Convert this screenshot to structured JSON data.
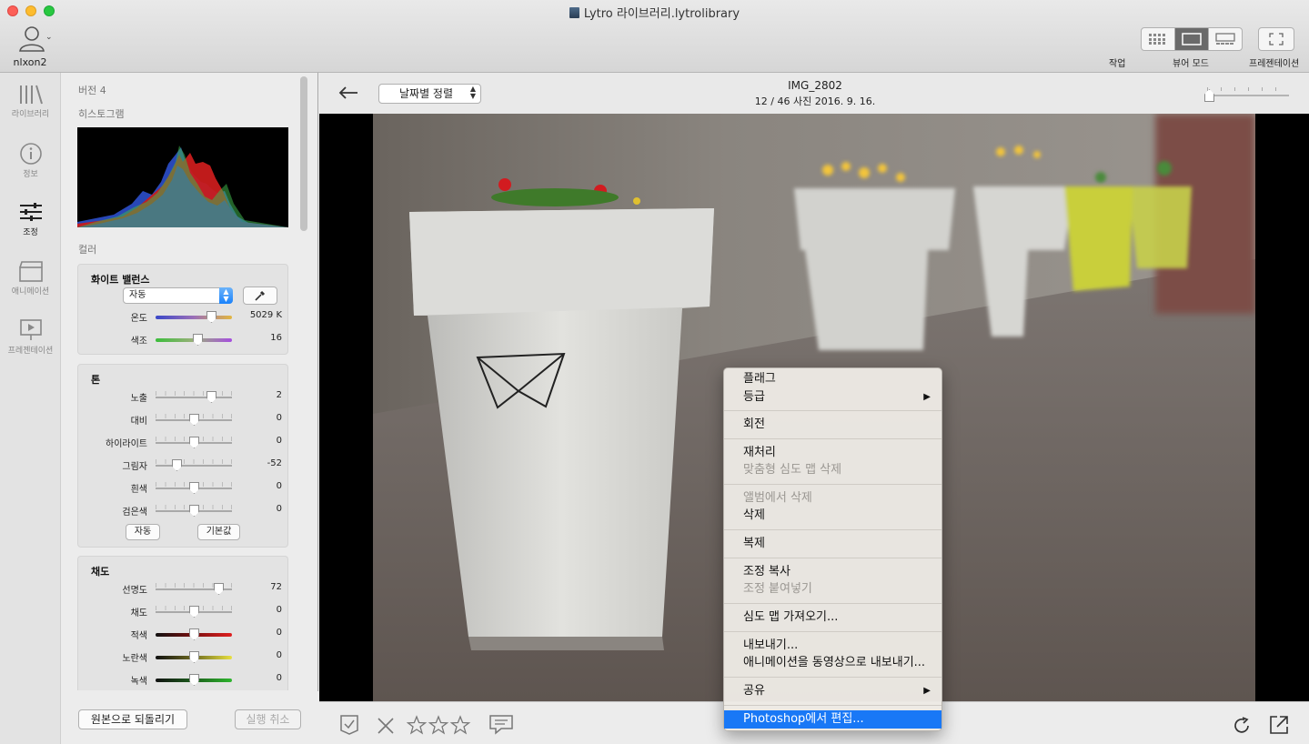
{
  "window": {
    "title": "Lytro 라이브러리.lytrolibrary"
  },
  "user": {
    "name": "nlxon2"
  },
  "toolbar": {
    "work_label": "작업",
    "viewer_mode_label": "뷰어 모드",
    "presentation_label": "프레젠테이션"
  },
  "rail": {
    "library": "라이브러리",
    "info": "정보",
    "adjust": "조정",
    "animation": "애니메이션",
    "presentation": "프레젠테이션"
  },
  "panel": {
    "version": "버전 4",
    "histogram_label": "히스토그램",
    "color_label": "컬러",
    "white_balance": {
      "title": "화이트 밸런스",
      "preset": "자동",
      "sliders": [
        {
          "label": "온도",
          "value": "5029 K",
          "pos": 0.72
        },
        {
          "label": "색조",
          "value": "16",
          "pos": 0.55
        }
      ]
    },
    "tone": {
      "title": "톤",
      "sliders": [
        {
          "label": "노출",
          "value": "2",
          "pos": 0.72
        },
        {
          "label": "대비",
          "value": "0",
          "pos": 0.5
        },
        {
          "label": "하이라이트",
          "value": "0",
          "pos": 0.5
        },
        {
          "label": "그림자",
          "value": "-52",
          "pos": 0.28
        },
        {
          "label": "흰색",
          "value": "0",
          "pos": 0.5
        },
        {
          "label": "검은색",
          "value": "0",
          "pos": 0.5
        }
      ],
      "auto_button": "자동",
      "default_button": "기본값"
    },
    "saturation": {
      "title": "채도",
      "sliders": [
        {
          "label": "선명도",
          "value": "72",
          "pos": 0.82
        },
        {
          "label": "채도",
          "value": "0",
          "pos": 0.5
        },
        {
          "label": "적색",
          "value": "0",
          "pos": 0.5
        },
        {
          "label": "노란색",
          "value": "0",
          "pos": 0.5
        },
        {
          "label": "녹색",
          "value": "0",
          "pos": 0.5
        }
      ]
    },
    "revert_button": "원본으로 되돌리기",
    "undo_button": "실행 취소"
  },
  "viewer": {
    "sort_label": "날짜별 정렬",
    "image_name": "IMG_2802",
    "image_meta": "12 / 46 사진  2016. 9. 16.",
    "zoom": 0.0
  },
  "context_menu": {
    "flag": "플래그",
    "rating": "등급",
    "rotate": "회전",
    "reprocess": "재처리",
    "delete_depth_map": "맞춤형 심도 맵 삭제",
    "remove_from_album": "앨범에서 삭제",
    "delete": "삭제",
    "duplicate": "복제",
    "copy_adjustments": "조정 복사",
    "paste_adjustments": "조정 붙여넣기",
    "import_depth_map": "심도 맵 가져오기...",
    "export": "내보내기...",
    "export_animation": "애니메이션을 동영상으로 내보내기...",
    "share": "공유",
    "edit_in_photoshop": "Photoshop에서 편집..."
  },
  "colors": {
    "accent": "#1978f6",
    "temp_grad_start": "#3a48c8",
    "temp_grad_end": "#e2b740",
    "tint_grad_start": "#3bbd3b",
    "tint_grad_end": "#a64de0"
  }
}
